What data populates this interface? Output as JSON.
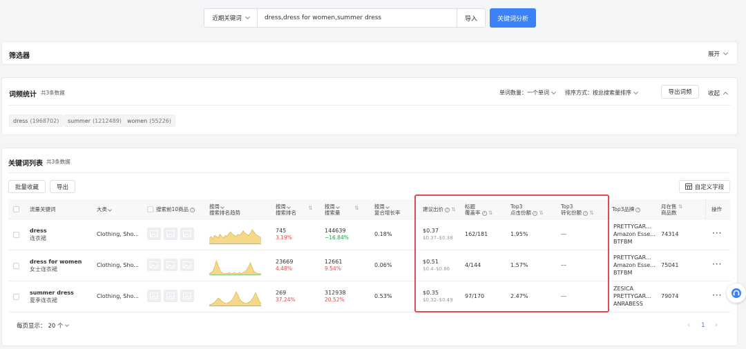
{
  "search": {
    "mode": "近期关键词",
    "query": "dress,dress for women,summer dress",
    "import_label": "导入",
    "analyze_label": "关键词分析"
  },
  "filter": {
    "title": "筛选器",
    "expand_label": "展开"
  },
  "stats": {
    "title": "词频统计",
    "count": "共3条数据",
    "word_count_label": "单词数量：一个单词",
    "sort_label": "排序方式：按总搜索量排序",
    "export_label": "导出词频",
    "collapse_label": "收起",
    "chips": [
      {
        "word": "dress",
        "count": "(1968702)"
      },
      {
        "word": "summer",
        "count": "(1212489)"
      },
      {
        "word": "women",
        "count": "(55226)"
      }
    ]
  },
  "table_section": {
    "title": "关键词列表",
    "count": "共3条数据",
    "batch_label": "批量收藏",
    "export_label": "导出",
    "custom_label": "自定义字段",
    "headers": {
      "keyword": "流量关键词",
      "category": "大类",
      "top10": "搜索前10商品",
      "trend1": "按周",
      "trend2": "搜索排名趋势",
      "rank1": "按周",
      "rank2": "搜索排名",
      "volume1": "按周",
      "volume2": "搜索量",
      "growth1": "按周",
      "growth2": "复合增长率",
      "bid": "建议出价",
      "cover1": "标题",
      "cover2": "覆盖率",
      "click1": "Top3",
      "click2": "点击份额",
      "conv1": "Top3",
      "conv2": "转化份额",
      "brands": "Top3品牌",
      "onsale1": "月在售",
      "onsale2": "商品数",
      "ops": "操作"
    },
    "rows": [
      {
        "keyword": "dress",
        "keyword_cn": "连衣裙",
        "category": "Clothing, Sho...",
        "rank": "745",
        "rank_change": "3.19%",
        "volume": "144639",
        "volume_change": "−16.84%",
        "growth": "0.18%",
        "bid": "$0.37",
        "bid_range": "$0.37–$0.38",
        "cover": "162/181",
        "click": "1.95%",
        "conv": "––",
        "brands": [
          "PRETTYGAR...",
          "Amazon Esse...",
          "BTFBM"
        ],
        "onsale": "74314",
        "trend": [
          5,
          6,
          4,
          7,
          6,
          5,
          8,
          6,
          5,
          7,
          6,
          9,
          10,
          8,
          7,
          6,
          8,
          7,
          9,
          11,
          9,
          8,
          7,
          9,
          12,
          10,
          8,
          7,
          6,
          5
        ]
      },
      {
        "keyword": "dress for women",
        "keyword_cn": "女士连衣裙",
        "category": "Clothing, Sho...",
        "rank": "23669",
        "rank_change": "4.48%",
        "volume": "12661",
        "volume_change": "9.54%",
        "growth": "0.06%",
        "bid": "$0.51",
        "bid_range": "$0.4–$0.86",
        "cover": "4/144",
        "click": "1.57%",
        "conv": "––",
        "brands": [
          "PRETTYGAR...",
          "Amazon Esse...",
          "BTFBM"
        ],
        "onsale": "75041",
        "trend": [
          1,
          2,
          3,
          8,
          14,
          9,
          4,
          2,
          1,
          1,
          1,
          2,
          1,
          1,
          2,
          1,
          1,
          2,
          1,
          2,
          3,
          5,
          8,
          12,
          7,
          3,
          2,
          1,
          1,
          1
        ]
      },
      {
        "keyword": "summer dress",
        "keyword_cn": "夏季连衣裙",
        "category": "Clothing, Sho...",
        "rank": "269",
        "rank_change": "37.24%",
        "volume": "312938",
        "volume_change": "20.52%",
        "growth": "0.53%",
        "bid": "$0.35",
        "bid_range": "$0.32–$0.49",
        "cover": "97/170",
        "click": "2.47%",
        "conv": "––",
        "brands": [
          "ZESICA",
          "PRETTYGAR...",
          "ANRABESS"
        ],
        "onsale": "79074",
        "trend": [
          1,
          1,
          2,
          3,
          5,
          7,
          6,
          4,
          3,
          2,
          2,
          3,
          4,
          6,
          9,
          13,
          10,
          6,
          4,
          3,
          2,
          2,
          3,
          4,
          6,
          9,
          12,
          8,
          4,
          2
        ]
      }
    ]
  },
  "pagination": {
    "page_size_label": "每页显示：",
    "page_size": "20 个",
    "current_page": "1"
  },
  "colors": {
    "primary": "#3b82f6",
    "highlight_box": "#e5484d",
    "trend_fill": "#f5d98a",
    "trend_stroke": "#e0b84a"
  }
}
